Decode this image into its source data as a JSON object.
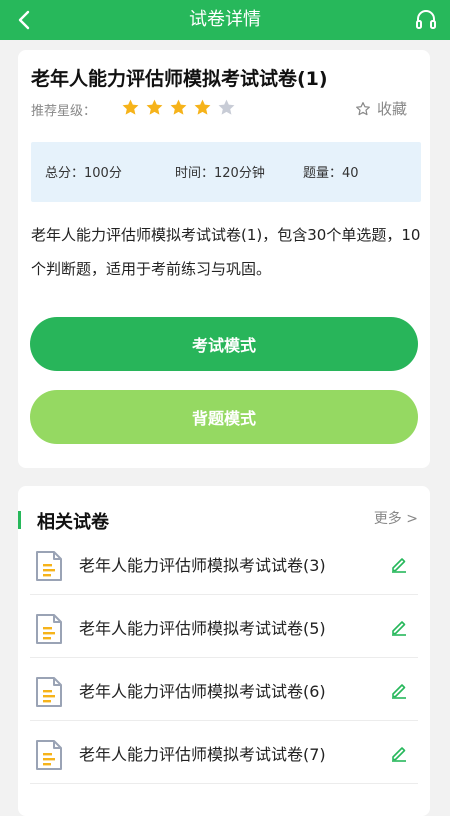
{
  "header": {
    "title": "试卷详情"
  },
  "paper": {
    "title": "老年人能力评估师模拟考试试卷(1)",
    "rating_label": "推荐星级：",
    "rating": 4,
    "rating_max": 5,
    "favorite_label": "收藏",
    "total_score": "总分：100分",
    "duration": "时间：120分钟",
    "question_count": "题量：40",
    "description": "老年人能力评估师模拟考试试卷(1)，包含30个单选题，10个判断题，适用于考前练习与巩固。"
  },
  "buttons": {
    "exam_mode": "考试模式",
    "review_mode": "背题模式"
  },
  "related": {
    "title": "相关试卷",
    "more": "更多 >",
    "items": [
      {
        "name": "老年人能力评估师模拟考试试卷(3)"
      },
      {
        "name": "老年人能力评估师模拟考试试卷(5)"
      },
      {
        "name": "老年人能力评估师模拟考试试卷(6)"
      },
      {
        "name": "老年人能力评估师模拟考试试卷(7)"
      }
    ]
  },
  "colors": {
    "brand": "#27b85b",
    "review_button": "#95d962",
    "star_on": "#f6b31a",
    "star_off": "#c8ccd6",
    "info_bg": "#e6f2fb"
  },
  "icons": {
    "back": "back-arrow-icon",
    "support": "headphones-icon",
    "favorite": "star-outline-icon",
    "document": "document-icon",
    "edit": "edit-icon"
  }
}
